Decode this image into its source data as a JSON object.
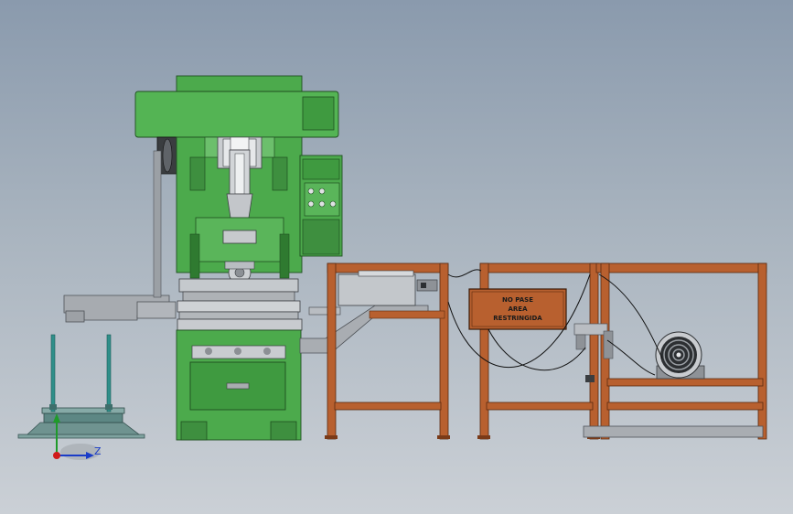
{
  "viewport": {
    "background_top": "#8a9aad",
    "background_bottom": "#cbd0d6"
  },
  "sign": {
    "line1": "NO PASE",
    "line2": "AREA",
    "line3": "RESTRINGIDA"
  },
  "triad": {
    "z_label": "Z"
  },
  "colors": {
    "press_green": "#4caa4c",
    "press_dark": "#2f7a30",
    "frame_rust": "#b8602f",
    "frame_dark": "#7a3a18",
    "steel_gray": "#b9bdc2",
    "teal_rods": "#2f8f8a"
  },
  "icons": {
    "triad": "xyz-axis-triad-icon",
    "fan": "motor-fan-icon"
  }
}
